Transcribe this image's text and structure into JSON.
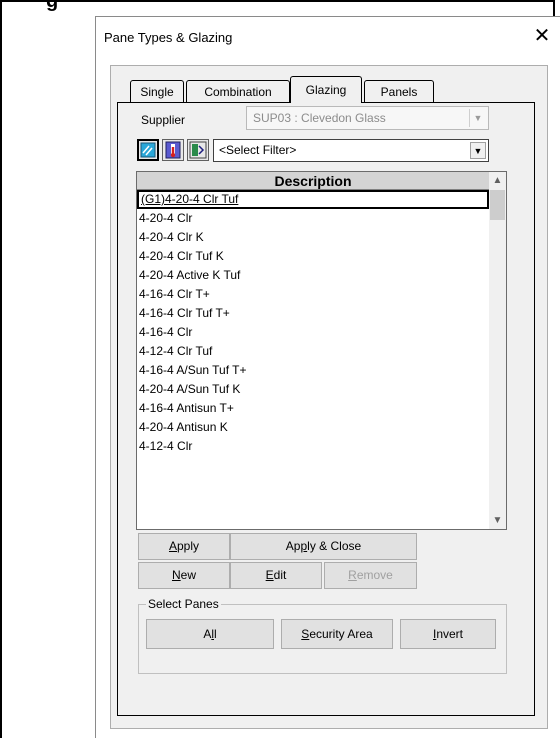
{
  "background_window": {
    "title": "g"
  },
  "dialog": {
    "title": "Pane Types & Glazing",
    "close_glyph": "✕"
  },
  "tabs": [
    {
      "label": "Single"
    },
    {
      "label": "Combination"
    },
    {
      "label": "Glazing",
      "active": true
    },
    {
      "label": "Panels"
    }
  ],
  "supplier": {
    "label": "Supplier",
    "value": "SUP03 : Clevedon Glass"
  },
  "filter": {
    "buttons": [
      "glass-filter-icon",
      "thermal-filter-icon",
      "acoustic-filter-icon"
    ],
    "value": "<Select Filter>"
  },
  "list": {
    "header": "Description",
    "rows": [
      "(G1)4-20-4 Clr Tuf",
      "4-20-4 Clr",
      "4-20-4 Clr K",
      "4-20-4 Clr Tuf K",
      "4-20-4 Active K Tuf",
      "4-16-4 Clr T+",
      "4-16-4 Clr Tuf T+",
      "4-16-4 Clr",
      "4-12-4 Clr Tuf",
      "4-16-4 A/Sun Tuf T+",
      "4-20-4 A/Sun Tuf K",
      "4-16-4 Antisun T+",
      "4-20-4 Antisun K",
      "4-12-4 Clr"
    ],
    "selected_index": 0
  },
  "buttons": {
    "apply": "Apply",
    "apply_close": "Apply & Close",
    "new": "New",
    "edit": "Edit",
    "remove": "Remove"
  },
  "select_panes": {
    "label": "Select Panes",
    "all": "All",
    "security_area": "Security Area",
    "invert": "Invert"
  },
  "colors": {
    "window_bg": "#f0f0f0",
    "list_header_bg": "#d4d4d4",
    "filter_glass": "#2aa7d8",
    "filter_thermal": "#d42020",
    "filter_acoustic": "#2a8a4a"
  }
}
